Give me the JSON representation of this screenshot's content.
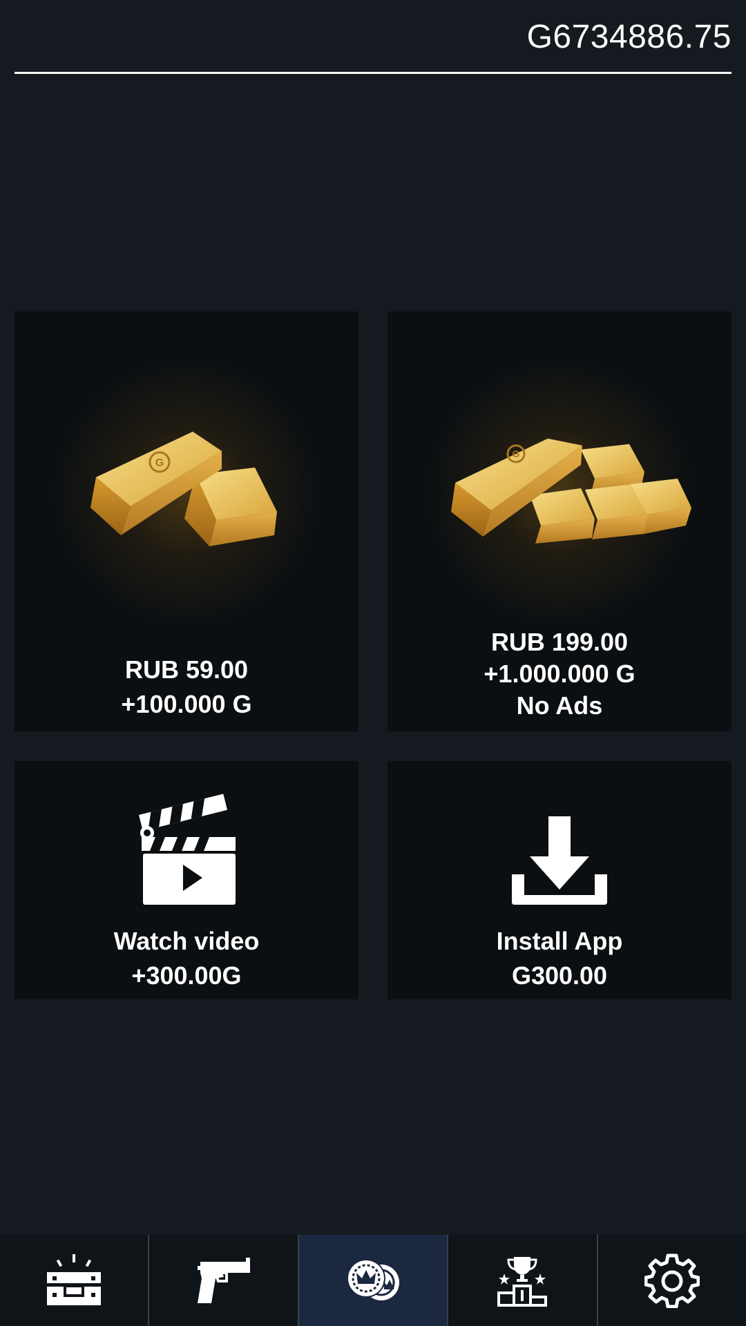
{
  "header": {
    "balance": "G6734886.75"
  },
  "offers": [
    {
      "price": "RUB 59.00",
      "reward": "+100.000 G",
      "image": "gold-bars-two"
    },
    {
      "price": "RUB 199.00",
      "reward": "+1.000.000 G",
      "extra": "No Ads",
      "image": "gold-bars-four"
    },
    {
      "title": "Watch video",
      "reward": "+300.00G",
      "icon": "clapperboard-icon"
    },
    {
      "title": "Install App",
      "reward": "G300.00",
      "icon": "download-icon"
    }
  ],
  "nav": {
    "items": [
      {
        "icon": "toolbox-icon"
      },
      {
        "icon": "pistol-icon"
      },
      {
        "icon": "coins-crown-icon",
        "active": true
      },
      {
        "icon": "trophy-podium-icon"
      },
      {
        "icon": "gear-icon"
      }
    ]
  },
  "colors": {
    "background": "#141a1f",
    "card": "#0b0f12",
    "nav_active": "#1b2840",
    "gold": "#e3b040"
  }
}
